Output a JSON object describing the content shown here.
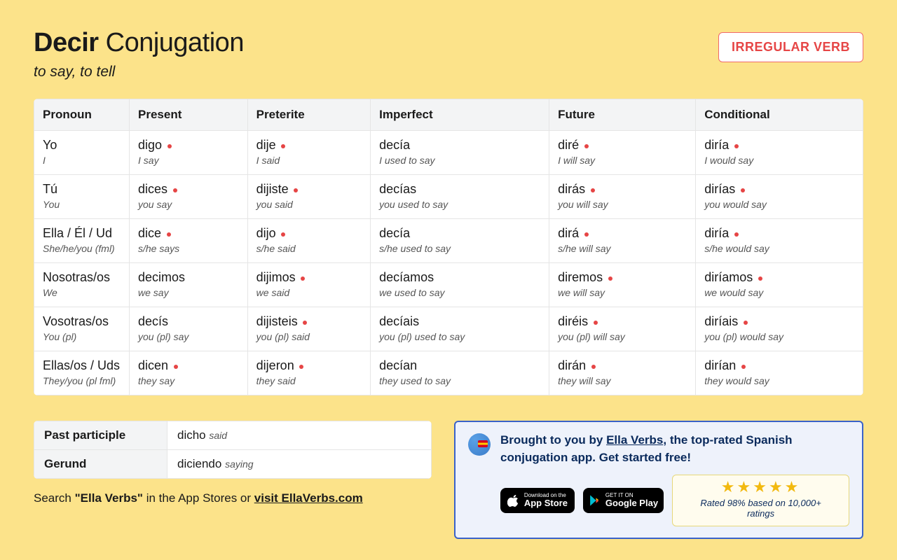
{
  "header": {
    "verb": "Decir",
    "conj_word": "Conjugation",
    "meaning": "to say, to tell",
    "badge": "IRREGULAR VERB"
  },
  "table": {
    "headers": [
      "Pronoun",
      "Present",
      "Preterite",
      "Imperfect",
      "Future",
      "Conditional"
    ],
    "rows": [
      {
        "pron_sp": "Yo",
        "pron_en": "I",
        "cells": [
          {
            "sp": "digo",
            "en": "I say",
            "irr": true
          },
          {
            "sp": "dije",
            "en": "I said",
            "irr": true
          },
          {
            "sp": "decía",
            "en": "I used to say",
            "irr": false
          },
          {
            "sp": "diré",
            "en": "I will say",
            "irr": true
          },
          {
            "sp": "diría",
            "en": "I would say",
            "irr": true
          }
        ]
      },
      {
        "pron_sp": "Tú",
        "pron_en": "You",
        "cells": [
          {
            "sp": "dices",
            "en": "you say",
            "irr": true
          },
          {
            "sp": "dijiste",
            "en": "you said",
            "irr": true
          },
          {
            "sp": "decías",
            "en": "you used to say",
            "irr": false
          },
          {
            "sp": "dirás",
            "en": "you will say",
            "irr": true
          },
          {
            "sp": "dirías",
            "en": "you would say",
            "irr": true
          }
        ]
      },
      {
        "pron_sp": "Ella / Él / Ud",
        "pron_en": "She/he/you (fml)",
        "cells": [
          {
            "sp": "dice",
            "en": "s/he says",
            "irr": true
          },
          {
            "sp": "dijo",
            "en": "s/he said",
            "irr": true
          },
          {
            "sp": "decía",
            "en": "s/he used to say",
            "irr": false
          },
          {
            "sp": "dirá",
            "en": "s/he will say",
            "irr": true
          },
          {
            "sp": "diría",
            "en": "s/he would say",
            "irr": true
          }
        ]
      },
      {
        "pron_sp": "Nosotras/os",
        "pron_en": "We",
        "cells": [
          {
            "sp": "decimos",
            "en": "we say",
            "irr": false
          },
          {
            "sp": "dijimos",
            "en": "we said",
            "irr": true
          },
          {
            "sp": "decíamos",
            "en": "we used to say",
            "irr": false
          },
          {
            "sp": "diremos",
            "en": "we will say",
            "irr": true
          },
          {
            "sp": "diríamos",
            "en": "we would say",
            "irr": true
          }
        ]
      },
      {
        "pron_sp": "Vosotras/os",
        "pron_en": "You (pl)",
        "cells": [
          {
            "sp": "decís",
            "en": "you (pl) say",
            "irr": false
          },
          {
            "sp": "dijisteis",
            "en": "you (pl) said",
            "irr": true
          },
          {
            "sp": "decíais",
            "en": "you (pl) used to say",
            "irr": false
          },
          {
            "sp": "diréis",
            "en": "you (pl) will say",
            "irr": true
          },
          {
            "sp": "diríais",
            "en": "you (pl) would say",
            "irr": true
          }
        ]
      },
      {
        "pron_sp": "Ellas/os / Uds",
        "pron_en": "They/you (pl fml)",
        "cells": [
          {
            "sp": "dicen",
            "en": "they say",
            "irr": true
          },
          {
            "sp": "dijeron",
            "en": "they said",
            "irr": true
          },
          {
            "sp": "decían",
            "en": "they used to say",
            "irr": false
          },
          {
            "sp": "dirán",
            "en": "they will say",
            "irr": true
          },
          {
            "sp": "dirían",
            "en": "they would say",
            "irr": true
          }
        ]
      }
    ]
  },
  "participles": {
    "pp_label": "Past participle",
    "pp_sp": "dicho",
    "pp_en": "said",
    "ger_label": "Gerund",
    "ger_sp": "diciendo",
    "ger_en": "saying"
  },
  "search_line": {
    "prefix": "Search ",
    "quoted": "\"Ella Verbs\"",
    "middle": " in the App Stores or ",
    "link": "visit EllaVerbs.com"
  },
  "promo": {
    "text_before": "Brought to you by ",
    "link": "Ella Verbs",
    "text_after": ", the top-rated Spanish conjugation app. Get started free!",
    "appstore_small": "Download on the",
    "appstore_big": "App Store",
    "play_small": "GET IT ON",
    "play_big": "Google Play",
    "stars": "★★★★★",
    "rating": "Rated 98% based on 10,000+ ratings"
  }
}
